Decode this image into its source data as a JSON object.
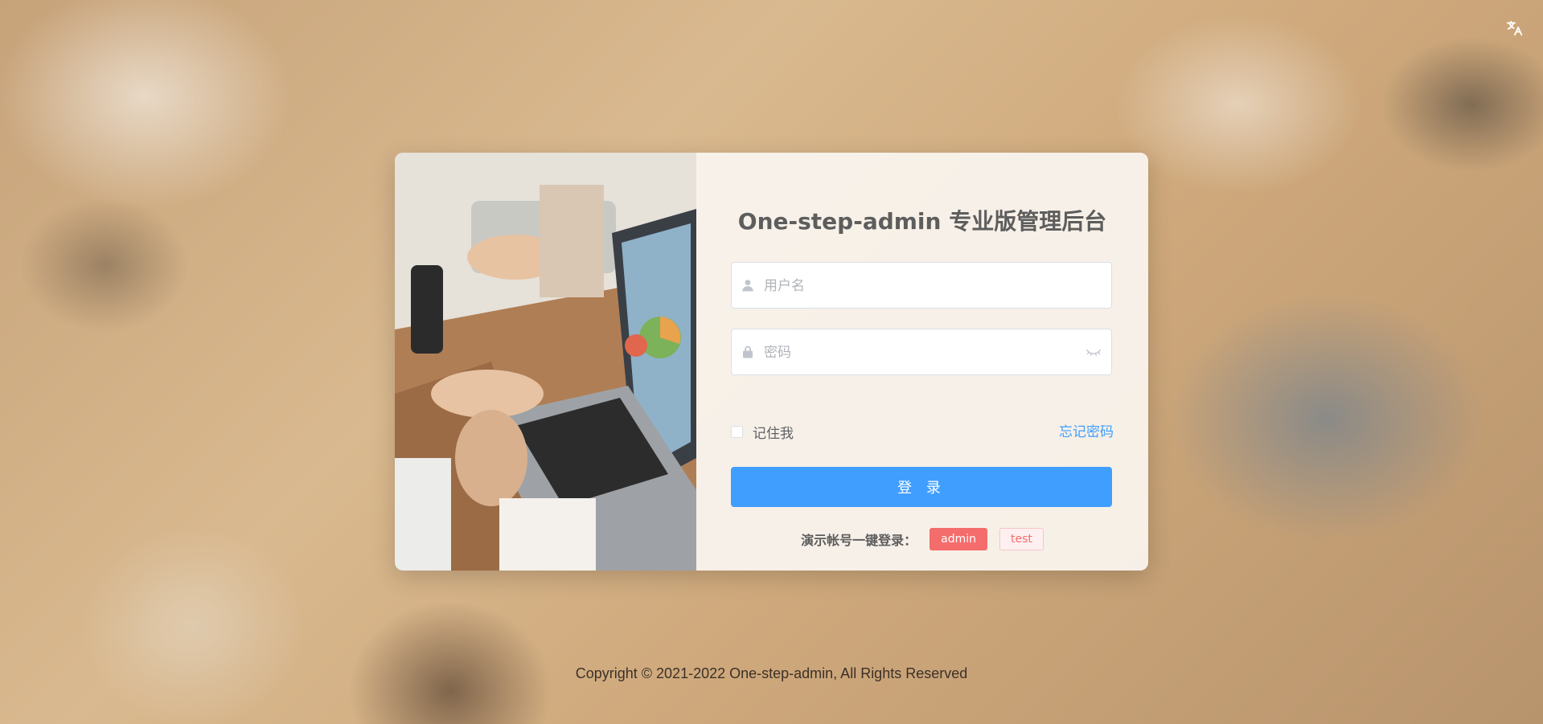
{
  "lang_switch": {
    "icon": "language-translate-icon"
  },
  "login": {
    "title": "One-step-admin 专业版管理后台",
    "username": {
      "placeholder": "用户名",
      "value": ""
    },
    "password": {
      "placeholder": "密码",
      "value": ""
    },
    "remember_label": "记住我",
    "forgot_label": "忘记密码",
    "login_button": "登 录",
    "demo_label": "演示帐号一键登录：",
    "demo_accounts": [
      "admin",
      "test"
    ]
  },
  "colors": {
    "primary": "#409eff",
    "danger": "#f56c6c",
    "title": "#5d5d5d"
  },
  "footer": {
    "copyright": "Copyright © 2021-2022 One-step-admin, All Rights Reserved"
  }
}
